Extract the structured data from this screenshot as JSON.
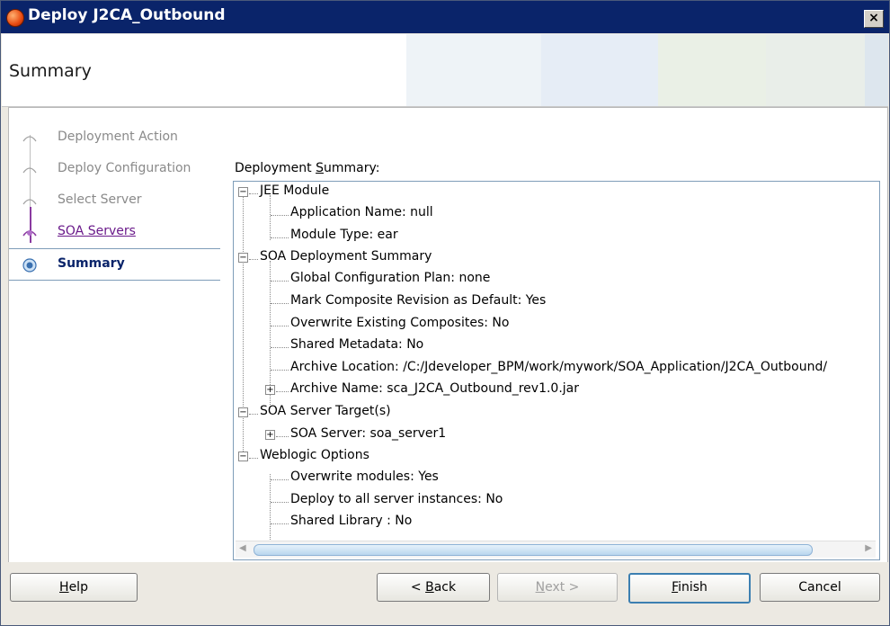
{
  "window": {
    "title": "Deploy J2CA_Outbound",
    "close_glyph": "×"
  },
  "header": {
    "title": "Summary"
  },
  "train": {
    "steps": [
      {
        "label": "Deployment Action",
        "state": "visited"
      },
      {
        "label": "Deploy Configuration",
        "state": "visited"
      },
      {
        "label": "Select Server",
        "state": "visited"
      },
      {
        "label": "SOA Servers",
        "state": "link"
      },
      {
        "label": "Summary",
        "state": "active"
      }
    ]
  },
  "content": {
    "section_label_pre": "Deployment ",
    "section_label_mnemonic": "S",
    "section_label_post": "ummary:",
    "tree": {
      "jee": {
        "label": "JEE Module",
        "app_name": "Application Name: null",
        "module_type": "Module Type: ear"
      },
      "soa": {
        "label": "SOA Deployment Summary",
        "global_plan": "Global Configuration Plan: none",
        "mark_default": "Mark Composite Revision as Default: Yes",
        "overwrite": "Overwrite Existing Composites: No",
        "shared_md": "Shared Metadata: No",
        "archive_location": "Archive Location: /C:/Jdeveloper_BPM/work/mywork/SOA_Application/J2CA_Outbound/",
        "archive_name": "Archive Name: sca_J2CA_Outbound_rev1.0.jar"
      },
      "target": {
        "label": "SOA Server Target(s)",
        "server": "SOA Server: soa_server1"
      },
      "wls": {
        "label": "Weblogic Options",
        "overwrite_modules": "Overwrite modules: Yes",
        "deploy_all": "Deploy to all server instances: No",
        "shared_lib": "Shared Library : No"
      }
    }
  },
  "buttons": {
    "help": {
      "mnemonic": "H",
      "rest": "elp"
    },
    "back": {
      "pre": "< ",
      "mnemonic": "B",
      "rest": "ack"
    },
    "next": {
      "mnemonic": "N",
      "rest": "ext >"
    },
    "finish": {
      "mnemonic": "F",
      "rest": "inish"
    },
    "cancel": {
      "label": "Cancel"
    }
  }
}
